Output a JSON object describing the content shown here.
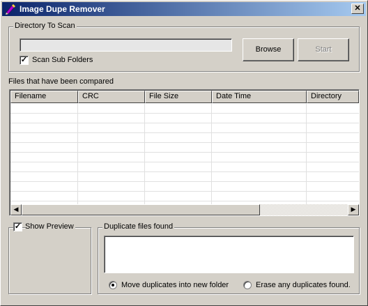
{
  "window": {
    "title": "Image Dupe Remover",
    "close_glyph": "✕"
  },
  "scan": {
    "group_label": "Directory To Scan",
    "directory_value": "",
    "subfolders_checked": true,
    "subfolders_label": "Scan Sub Folders",
    "check_glyph": "✓",
    "browse_label": "Browse",
    "start_label": "Start"
  },
  "files": {
    "label": "Files that have been compared",
    "columns": [
      "Filename",
      "CRC",
      "File Size",
      "Date Time",
      "Directory"
    ],
    "rows": [],
    "scroll_left_glyph": "◀",
    "scroll_right_glyph": "▶"
  },
  "preview": {
    "label": "Show Preview",
    "checked": true
  },
  "duplicates": {
    "group_label": "Duplicate files found",
    "items": [],
    "options": [
      {
        "label": "Move duplicates into new folder",
        "selected": true
      },
      {
        "label": "Erase any duplicates found.",
        "selected": false
      }
    ]
  },
  "icons": {
    "app": "pencil-app-icon",
    "close": "close-icon",
    "check": "checkmark-icon",
    "scroll_left": "arrow-left-icon",
    "scroll_right": "arrow-right-icon"
  },
  "colors": {
    "titlebar_start": "#0a246a",
    "titlebar_end": "#a6caf0",
    "face": "#d4d0c8"
  }
}
